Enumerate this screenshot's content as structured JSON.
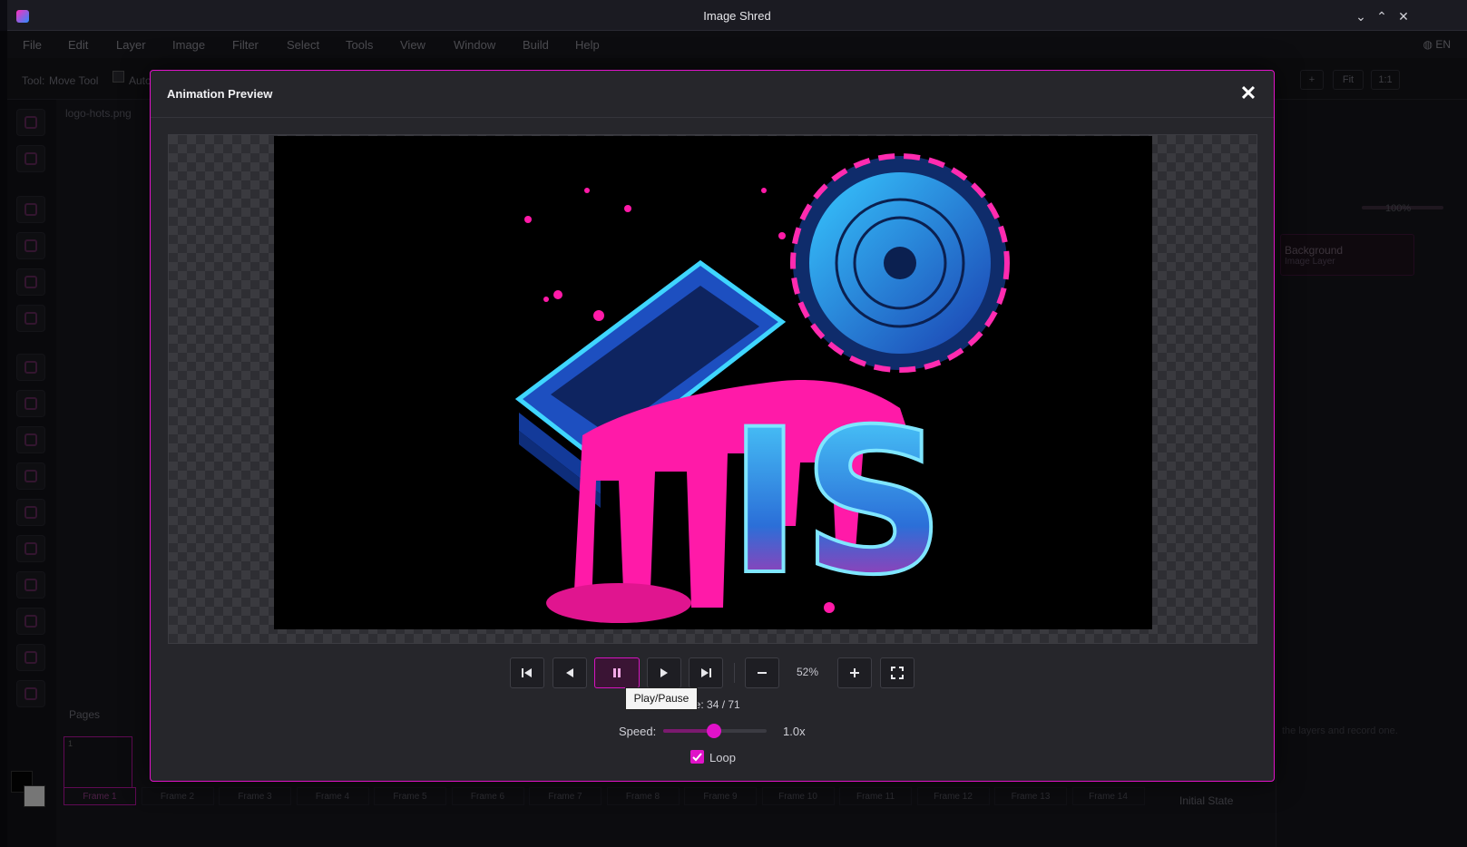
{
  "window": {
    "title": "Image Shred"
  },
  "menu": [
    "File",
    "Edit",
    "Layer",
    "Image",
    "Filter",
    "Select",
    "Tools",
    "View",
    "Window",
    "Build",
    "Help"
  ],
  "language": "EN",
  "tool_options": {
    "tool_label": "Tool:",
    "tool_name": "Move Tool",
    "auto_label": "Auto",
    "fit": "Fit",
    "one_to_one": "1:1",
    "plus": "+"
  },
  "document_tab": "logo-hots.png",
  "right_panel": {
    "opacity": "100%",
    "layer_name": "Background",
    "layer_type": "Image Layer",
    "history_hint": "the layers and record one.",
    "initial_state": "Initial State"
  },
  "pages": {
    "label": "Pages",
    "first_frame_number": "1"
  },
  "frames": [
    "Frame 1",
    "Frame 2",
    "Frame 3",
    "Frame 4",
    "Frame 5",
    "Frame 6",
    "Frame 7",
    "Frame 8",
    "Frame 9",
    "Frame 10",
    "Frame 11",
    "Frame 12",
    "Frame 13",
    "Frame 14"
  ],
  "modal": {
    "title": "Animation Preview",
    "close": "✕",
    "zoom": "52%",
    "frame_info": "ne: 34 / 71",
    "tooltip": "Play/Pause",
    "speed_label": "Speed:",
    "speed_value": "1.0x",
    "speed_fraction": 0.49,
    "loop_label": "Loop",
    "loop_checked": true
  },
  "colors": {
    "accent": "#e012c8",
    "pink": "#ff1aa8",
    "cyan": "#2fd0ff",
    "blue": "#1c5fd0"
  }
}
